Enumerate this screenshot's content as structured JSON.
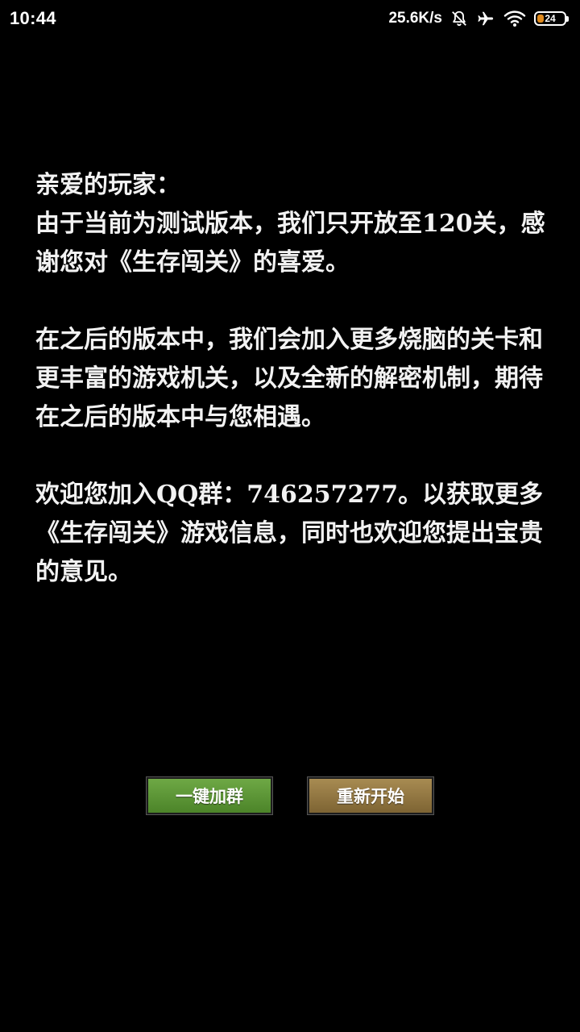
{
  "status_bar": {
    "time": "10:44",
    "net_speed": "25.6K/s",
    "battery_level": "24",
    "battery_fraction": 0.24,
    "icons": [
      "bell-muted-icon",
      "airplane-icon",
      "wifi-icon",
      "battery-icon"
    ],
    "battery_color": "#e08a1c"
  },
  "message": {
    "greeting": "亲爱的玩家：",
    "p1": "由于当前为测试版本，我们只开放至120关，感谢您对《生存闯关》的喜爱。",
    "p2": "在之后的版本中，我们会加入更多烧脑的关卡和更丰富的游戏机关，以及全新的解密机制，期待在之后的版本中与您相遇。",
    "p3": "欢迎您加入QQ群：746257277。以获取更多《生存闯关》游戏信息，同时也欢迎您提出宝贵的意见。"
  },
  "buttons": {
    "join_group": "一键加群",
    "restart": "重新开始"
  },
  "colors": {
    "background": "#000000",
    "join_button": "#5e9a39",
    "restart_button": "#9a7d45"
  }
}
